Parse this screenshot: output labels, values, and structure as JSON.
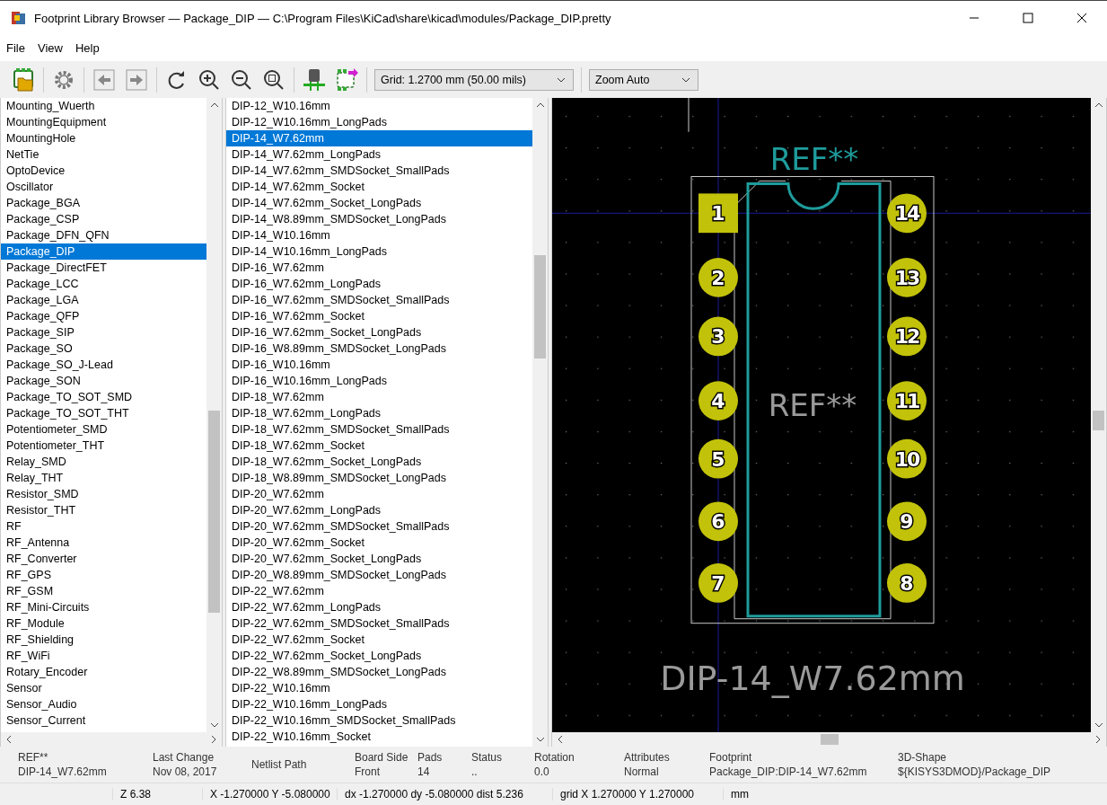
{
  "window": {
    "title": "Footprint Library Browser — Package_DIP — C:\\Program Files\\KiCad\\share\\kicad\\modules/Package_DIP.pretty"
  },
  "menu": [
    "File",
    "View",
    "Help"
  ],
  "toolbar": {
    "grid": "Grid: 1.2700 mm (50.00 mils)",
    "zoom": "Zoom Auto"
  },
  "libraries": [
    {
      "name": "Mounting_Wuerth",
      "selected": false
    },
    {
      "name": "MountingEquipment",
      "selected": false
    },
    {
      "name": "MountingHole",
      "selected": false
    },
    {
      "name": "NetTie",
      "selected": false
    },
    {
      "name": "OptoDevice",
      "selected": false
    },
    {
      "name": "Oscillator",
      "selected": false
    },
    {
      "name": "Package_BGA",
      "selected": false
    },
    {
      "name": "Package_CSP",
      "selected": false
    },
    {
      "name": "Package_DFN_QFN",
      "selected": false
    },
    {
      "name": "Package_DIP",
      "selected": true
    },
    {
      "name": "Package_DirectFET",
      "selected": false
    },
    {
      "name": "Package_LCC",
      "selected": false
    },
    {
      "name": "Package_LGA",
      "selected": false
    },
    {
      "name": "Package_QFP",
      "selected": false
    },
    {
      "name": "Package_SIP",
      "selected": false
    },
    {
      "name": "Package_SO",
      "selected": false
    },
    {
      "name": "Package_SO_J-Lead",
      "selected": false
    },
    {
      "name": "Package_SON",
      "selected": false
    },
    {
      "name": "Package_TO_SOT_SMD",
      "selected": false
    },
    {
      "name": "Package_TO_SOT_THT",
      "selected": false
    },
    {
      "name": "Potentiometer_SMD",
      "selected": false
    },
    {
      "name": "Potentiometer_THT",
      "selected": false
    },
    {
      "name": "Relay_SMD",
      "selected": false
    },
    {
      "name": "Relay_THT",
      "selected": false
    },
    {
      "name": "Resistor_SMD",
      "selected": false
    },
    {
      "name": "Resistor_THT",
      "selected": false
    },
    {
      "name": "RF",
      "selected": false
    },
    {
      "name": "RF_Antenna",
      "selected": false
    },
    {
      "name": "RF_Converter",
      "selected": false
    },
    {
      "name": "RF_GPS",
      "selected": false
    },
    {
      "name": "RF_GSM",
      "selected": false
    },
    {
      "name": "RF_Mini-Circuits",
      "selected": false
    },
    {
      "name": "RF_Module",
      "selected": false
    },
    {
      "name": "RF_Shielding",
      "selected": false
    },
    {
      "name": "RF_WiFi",
      "selected": false
    },
    {
      "name": "Rotary_Encoder",
      "selected": false
    },
    {
      "name": "Sensor",
      "selected": false
    },
    {
      "name": "Sensor_Audio",
      "selected": false
    },
    {
      "name": "Sensor_Current",
      "selected": false
    }
  ],
  "footprints": [
    {
      "name": "DIP-12_W10.16mm",
      "selected": false
    },
    {
      "name": "DIP-12_W10.16mm_LongPads",
      "selected": false
    },
    {
      "name": "DIP-14_W7.62mm",
      "selected": true
    },
    {
      "name": "DIP-14_W7.62mm_LongPads",
      "selected": false
    },
    {
      "name": "DIP-14_W7.62mm_SMDSocket_SmallPads",
      "selected": false
    },
    {
      "name": "DIP-14_W7.62mm_Socket",
      "selected": false
    },
    {
      "name": "DIP-14_W7.62mm_Socket_LongPads",
      "selected": false
    },
    {
      "name": "DIP-14_W8.89mm_SMDSocket_LongPads",
      "selected": false
    },
    {
      "name": "DIP-14_W10.16mm",
      "selected": false
    },
    {
      "name": "DIP-14_W10.16mm_LongPads",
      "selected": false
    },
    {
      "name": "DIP-16_W7.62mm",
      "selected": false
    },
    {
      "name": "DIP-16_W7.62mm_LongPads",
      "selected": false
    },
    {
      "name": "DIP-16_W7.62mm_SMDSocket_SmallPads",
      "selected": false
    },
    {
      "name": "DIP-16_W7.62mm_Socket",
      "selected": false
    },
    {
      "name": "DIP-16_W7.62mm_Socket_LongPads",
      "selected": false
    },
    {
      "name": "DIP-16_W8.89mm_SMDSocket_LongPads",
      "selected": false
    },
    {
      "name": "DIP-16_W10.16mm",
      "selected": false
    },
    {
      "name": "DIP-16_W10.16mm_LongPads",
      "selected": false
    },
    {
      "name": "DIP-18_W7.62mm",
      "selected": false
    },
    {
      "name": "DIP-18_W7.62mm_LongPads",
      "selected": false
    },
    {
      "name": "DIP-18_W7.62mm_SMDSocket_SmallPads",
      "selected": false
    },
    {
      "name": "DIP-18_W7.62mm_Socket",
      "selected": false
    },
    {
      "name": "DIP-18_W7.62mm_Socket_LongPads",
      "selected": false
    },
    {
      "name": "DIP-18_W8.89mm_SMDSocket_LongPads",
      "selected": false
    },
    {
      "name": "DIP-20_W7.62mm",
      "selected": false
    },
    {
      "name": "DIP-20_W7.62mm_LongPads",
      "selected": false
    },
    {
      "name": "DIP-20_W7.62mm_SMDSocket_SmallPads",
      "selected": false
    },
    {
      "name": "DIP-20_W7.62mm_Socket",
      "selected": false
    },
    {
      "name": "DIP-20_W7.62mm_Socket_LongPads",
      "selected": false
    },
    {
      "name": "DIP-20_W8.89mm_SMDSocket_LongPads",
      "selected": false
    },
    {
      "name": "DIP-22_W7.62mm",
      "selected": false
    },
    {
      "name": "DIP-22_W7.62mm_LongPads",
      "selected": false
    },
    {
      "name": "DIP-22_W7.62mm_SMDSocket_SmallPads",
      "selected": false
    },
    {
      "name": "DIP-22_W7.62mm_Socket",
      "selected": false
    },
    {
      "name": "DIP-22_W7.62mm_Socket_LongPads",
      "selected": false
    },
    {
      "name": "DIP-22_W8.89mm_SMDSocket_LongPads",
      "selected": false
    },
    {
      "name": "DIP-22_W10.16mm",
      "selected": false
    },
    {
      "name": "DIP-22_W10.16mm_LongPads",
      "selected": false
    },
    {
      "name": "DIP-22_W10.16mm_SMDSocket_SmallPads",
      "selected": false
    },
    {
      "name": "DIP-22_W10.16mm_Socket",
      "selected": false
    }
  ],
  "canvas": {
    "reference_top": "REF**",
    "reference_center": "REF**",
    "value": "DIP-14_W7.62mm",
    "pads": [
      {
        "number": "1",
        "kind": "square"
      },
      {
        "number": "14",
        "kind": "round"
      },
      {
        "number": "2",
        "kind": "round"
      },
      {
        "number": "13",
        "kind": "round"
      },
      {
        "number": "3",
        "kind": "round"
      },
      {
        "number": "12",
        "kind": "round"
      },
      {
        "number": "4",
        "kind": "round"
      },
      {
        "number": "11",
        "kind": "round"
      },
      {
        "number": "5",
        "kind": "round"
      },
      {
        "number": "10",
        "kind": "round"
      },
      {
        "number": "6",
        "kind": "round"
      },
      {
        "number": "9",
        "kind": "round"
      },
      {
        "number": "7",
        "kind": "round"
      },
      {
        "number": "8",
        "kind": "round"
      }
    ]
  },
  "info": [
    {
      "label": "REF**",
      "value": "DIP-14_W7.62mm"
    },
    {
      "label": "Last Change",
      "value": "Nov 08, 2017"
    },
    {
      "label": "Netlist Path"
    },
    {
      "label": "Board Side",
      "value": "Front"
    },
    {
      "label": "Pads",
      "value": "14"
    },
    {
      "label": "Status",
      "value": ".."
    },
    {
      "label": "Rotation",
      "value": "0.0"
    },
    {
      "label": "Attributes",
      "value": "Normal"
    },
    {
      "label": "Footprint",
      "value": "Package_DIP:DIP-14_W7.62mm"
    },
    {
      "label": "3D-Shape",
      "value": "${KISYS3DMOD}/Package_DIP"
    }
  ],
  "status_bar": [
    "Z 6.38",
    "X -1.270000  Y -5.080000",
    "dx -1.270000  dy -5.080000  dist 5.236",
    "grid X 1.270000  Y 1.270000",
    "mm"
  ]
}
